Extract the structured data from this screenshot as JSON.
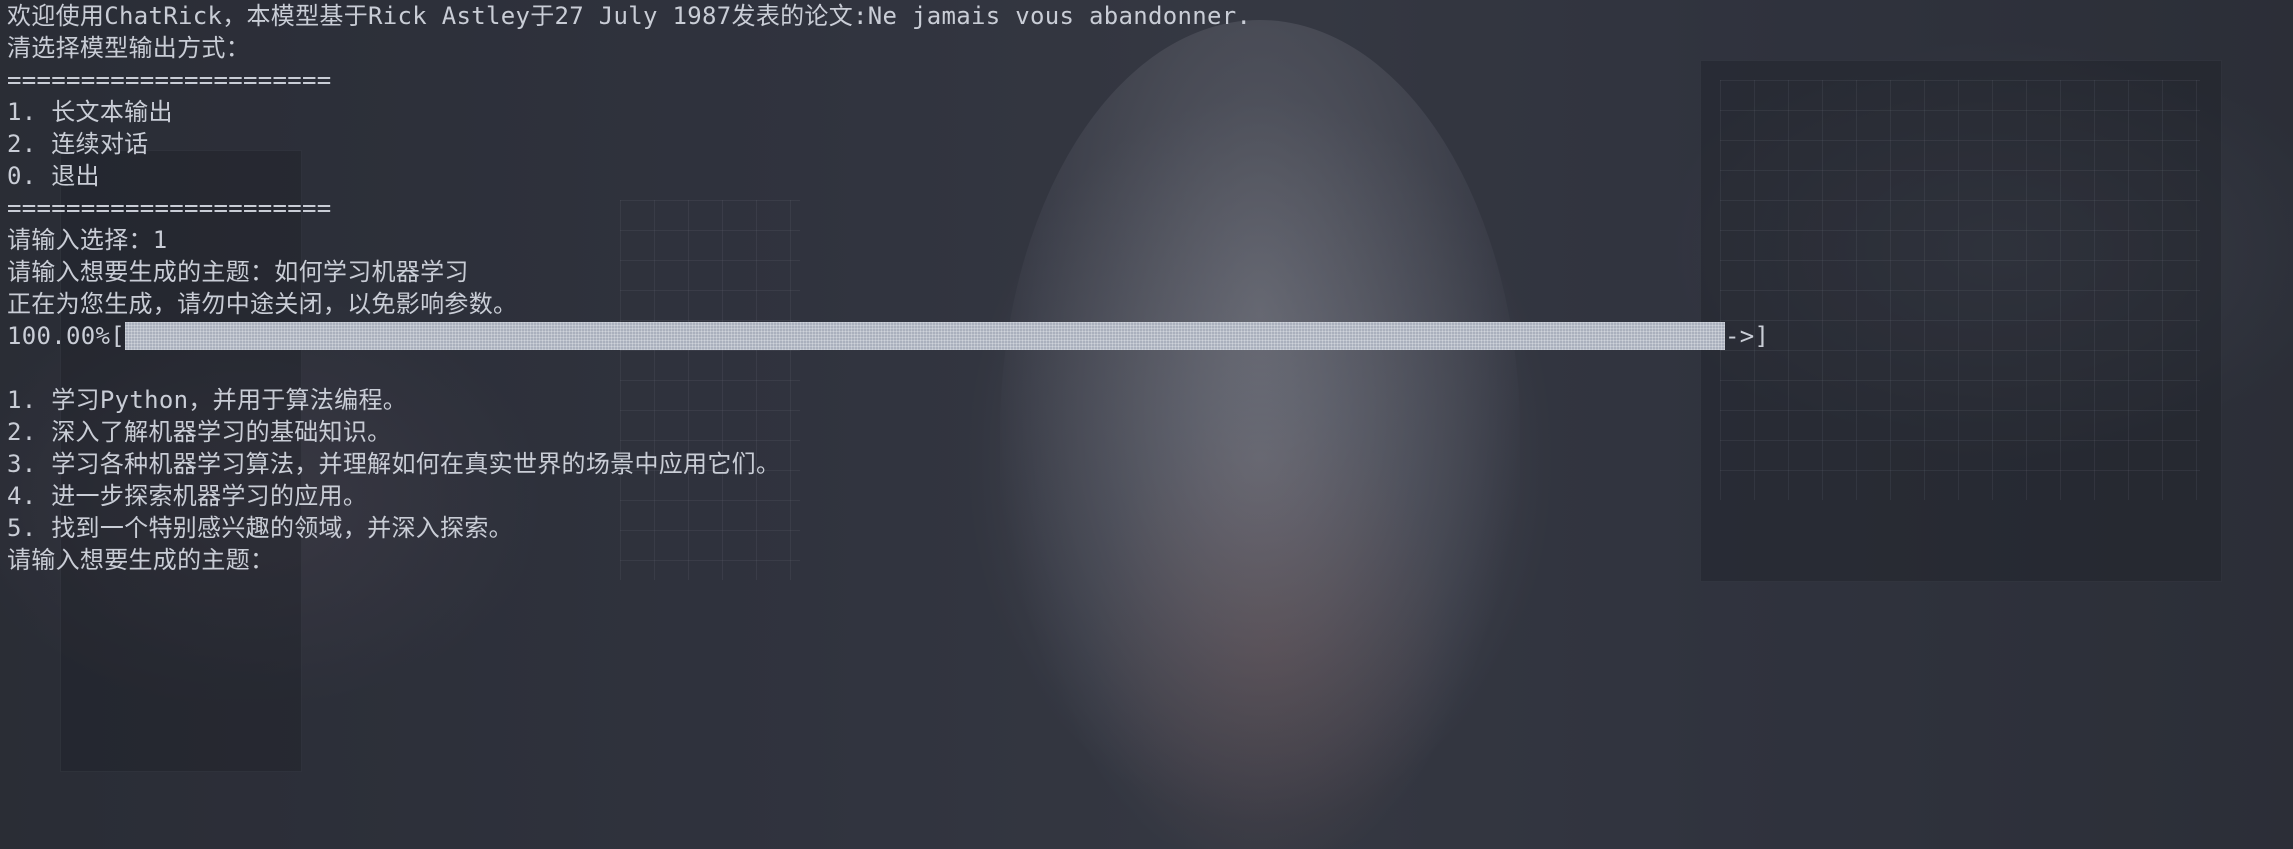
{
  "terminal": {
    "welcome": "欢迎使用ChatRick，本模型基于Rick Astley于27 July 1987发表的论文:Ne jamais vous abandonner.",
    "choose_mode": "清选择模型输出方式：",
    "separator": "======================",
    "menu": [
      "1. 长文本输出",
      "2. 连续对话",
      "0. 退出"
    ],
    "separator_end": "======================",
    "input_choice": "请输入选择：1",
    "input_topic": "请输入想要生成的主题：如何学习机器学习",
    "generating": "正在为您生成，请勿中途关闭，以免影响参数。",
    "progress": {
      "percent_label": "100.00%[",
      "value": 1.0,
      "end": "->]"
    },
    "results": [
      "1. 学习Python，并用于算法编程。",
      "2. 深入了解机器学习的基础知识。",
      "3. 学习各种机器学习算法，并理解如何在真实世界的场景中应用它们。",
      "4. 进一步探索机器学习的应用。",
      "5. 找到一个特别感兴趣的领域，并深入探索。"
    ],
    "prompt": "请输入想要生成的主题："
  }
}
